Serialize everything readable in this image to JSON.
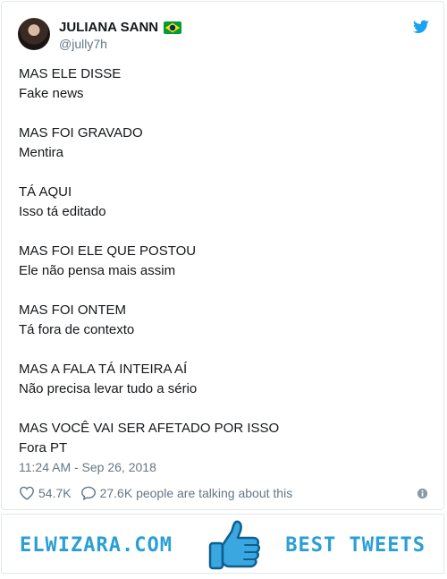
{
  "tweet": {
    "author": {
      "name": "JULIANA SANN",
      "handle": "@jully7h"
    },
    "paragraphs": [
      [
        "MAS ELE DISSE",
        "Fake news"
      ],
      [
        "MAS FOI GRAVADO",
        "Mentira"
      ],
      [
        "TÁ AQUI",
        "Isso tá editado"
      ],
      [
        "MAS FOI ELE QUE POSTOU",
        "Ele não pensa mais assim"
      ],
      [
        "MAS FOI ONTEM",
        "Tá fora de contexto"
      ],
      [
        "MAS A FALA TÁ INTEIRA AÍ",
        "Não precisa levar tudo a sério"
      ],
      [
        "MAS VOCÊ VAI SER AFETADO POR ISSO",
        "Fora PT"
      ]
    ],
    "timestamp": "11:24 AM - Sep 26, 2018",
    "likes": "54.7K",
    "replies": "27.6K people are talking about this"
  },
  "footer": {
    "left_text": "ELWIZARA.COM",
    "right_text": "BEST TWEETS"
  },
  "colors": {
    "twitter_blue": "#1da1f2",
    "muted": "#657786",
    "footer_blue": "#2a9fd6"
  }
}
